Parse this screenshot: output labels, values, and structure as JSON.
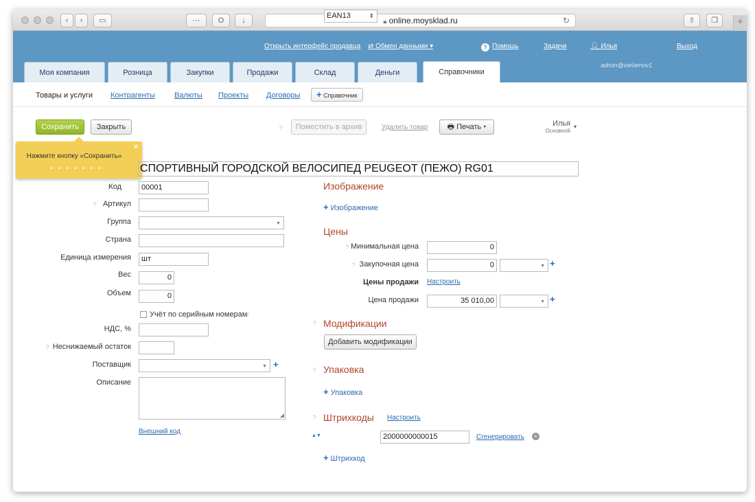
{
  "browser": {
    "url": "online.moysklad.ru",
    "icons": [
      "back-icon",
      "forward-icon",
      "sidebar-icon",
      "grid-icon",
      "opera-icon",
      "download-icon",
      "lock-icon",
      "reload-icon",
      "share-icon",
      "tabs-icon",
      "new-tab-icon"
    ]
  },
  "header": {
    "seller_link": "Открыть интерфейс продавца",
    "exchange_link": "Обмен данными",
    "help_link": "Помощь",
    "tasks_link": "Задачи",
    "user_name": "Илья",
    "user_login": "admin@varlamov1",
    "logout_link": "Выход",
    "colors": {
      "bar": "#5d97c3",
      "accent_green": "#9bc23a",
      "section_red": "#b3432a",
      "link_blue": "#2a6ab0",
      "tooltip_yellow": "#f3cf58"
    }
  },
  "tabs": [
    {
      "label": "Моя компания"
    },
    {
      "label": "Розница"
    },
    {
      "label": "Закупки"
    },
    {
      "label": "Продажи"
    },
    {
      "label": "Склад"
    },
    {
      "label": "Деньги"
    },
    {
      "label": "Справочники"
    }
  ],
  "subnav": {
    "items": [
      "Товары и услуги",
      "Контрагенты",
      "Валюты",
      "Проекты",
      "Договоры"
    ],
    "add_button": "Справочник"
  },
  "toolbar": {
    "save": "Сохранить",
    "close": "Закрыть",
    "archive": "Поместить в архив",
    "delete": "Удалить товар",
    "print": "Печать",
    "owner_name": "Илья",
    "owner_group": "Основной"
  },
  "tooltip": {
    "text": "Нажмите кнопку «Сохранить»",
    "close": "×",
    "dots": "• • • • • • •"
  },
  "product": {
    "title": "СПОРТИВНЫЙ ГОРОДСКОЙ ВЕЛОСИПЕД PEUGEOT (ПЕЖО) RG01"
  },
  "form": {
    "code_label": "Код",
    "code_value": "00001",
    "article_label": "Артикул",
    "article_value": "",
    "group_label": "Группа",
    "group_value": "",
    "country_label": "Страна",
    "country_value": "",
    "unit_label": "Единица измерения",
    "unit_value": "шт",
    "weight_label": "Вес",
    "weight_value": "0",
    "volume_label": "Объем",
    "volume_value": "0",
    "serial_label": "Учёт по серийным номерам",
    "vat_label": "НДС, %",
    "vat_value": "",
    "min_stock_label": "Неснижаемый остаток",
    "min_stock_value": "",
    "supplier_label": "Поставщик",
    "supplier_value": "",
    "description_label": "Описание",
    "external_code_link": "Внешний код"
  },
  "image_section": {
    "title": "Изображение",
    "add": "Изображение"
  },
  "prices": {
    "title": "Цены",
    "min_price_label": "Минимальная цена",
    "min_price_value": "0",
    "purchase_price_label": "Закупочная цена",
    "purchase_price_value": "0",
    "sale_prices_label": "Цены продажи",
    "configure": "Настроить",
    "sale_price_label": "Цена продажи",
    "sale_price_value": "35 010,00"
  },
  "modifications": {
    "title": "Модификации",
    "add_button": "Добавить модификации"
  },
  "packaging": {
    "title": "Упаковка",
    "add": "Упаковка"
  },
  "barcodes": {
    "title": "Штрихкоды",
    "configure": "Настроить",
    "type": "EAN13",
    "value": "2000000000015",
    "generate": "Сгенерировать",
    "add": "Штрихкод"
  }
}
